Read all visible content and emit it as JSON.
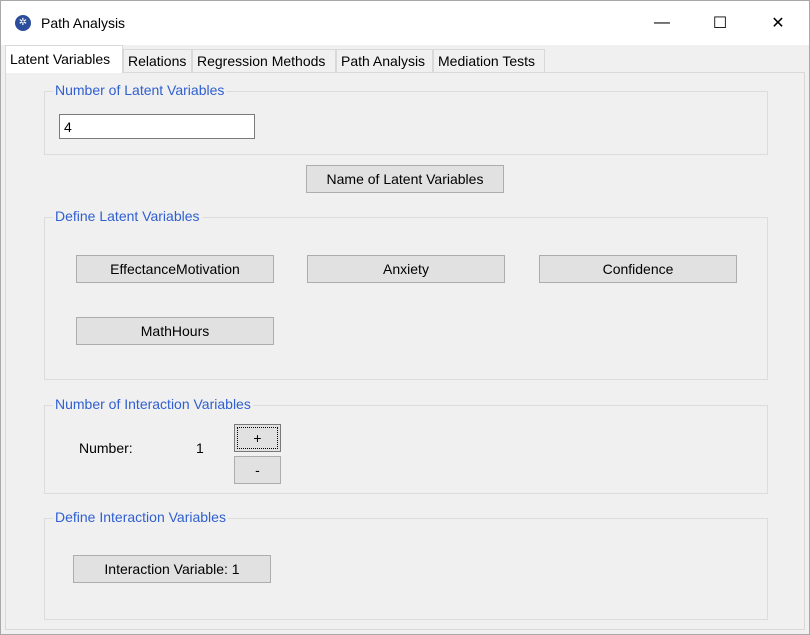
{
  "window": {
    "title": "Path Analysis",
    "minimize": "—",
    "maximize": "☐",
    "close": "✕"
  },
  "tabs": [
    {
      "label": "Latent Variables"
    },
    {
      "label": "Relations"
    },
    {
      "label": "Regression Methods"
    },
    {
      "label": "Path Analysis"
    },
    {
      "label": "Mediation Tests"
    }
  ],
  "num_latent": {
    "legend": "Number of Latent Variables",
    "value": "4"
  },
  "name_latent_button": "Name of Latent Variables",
  "define_latent": {
    "legend": "Define Latent Variables",
    "variables": [
      "EffectanceMotivation",
      "Anxiety",
      "Confidence",
      "MathHours"
    ]
  },
  "num_interaction": {
    "legend": "Number of Interaction Variables",
    "label": "Number:",
    "value": "1",
    "plus": "+",
    "minus": "-"
  },
  "define_interaction": {
    "legend": "Define Interaction Variables",
    "variables": [
      "Interaction Variable: 1"
    ]
  }
}
